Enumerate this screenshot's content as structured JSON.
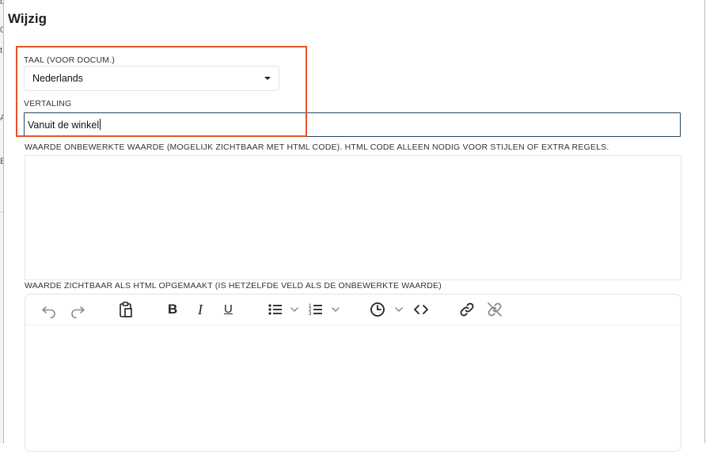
{
  "dialog": {
    "title": "Wijzig"
  },
  "language_field": {
    "label": "TAAL (VOOR DOCUM.)",
    "selected": "Nederlands"
  },
  "translation_field": {
    "label": "VERTALING",
    "value": "Vanuit de winkel"
  },
  "raw_value_field": {
    "label": "WAARDE ONBEWERKTE WAARDE (MOGELIJK ZICHTBAAR MET HTML CODE). HTML CODE ALLEEN NODIG VOOR STIJLEN OF EXTRA REGELS.",
    "value": ""
  },
  "html_value_field": {
    "label": "WAARDE ZICHTBAAR ALS HTML OPGEMAAKT (IS HETZELFDE VELD ALS DE ONBEWERKTE WAARDE)"
  },
  "editor_toolbar": {
    "bold": "B",
    "italic": "I",
    "underline": "U",
    "icons": [
      "undo-icon",
      "redo-icon",
      "paste-icon",
      "bold-icon",
      "italic-icon",
      "underline-icon",
      "bullet-list-icon",
      "numbered-list-icon",
      "clock-icon",
      "code-icon",
      "link-icon",
      "unlink-icon"
    ]
  },
  "highlight_color": "#e6512b"
}
